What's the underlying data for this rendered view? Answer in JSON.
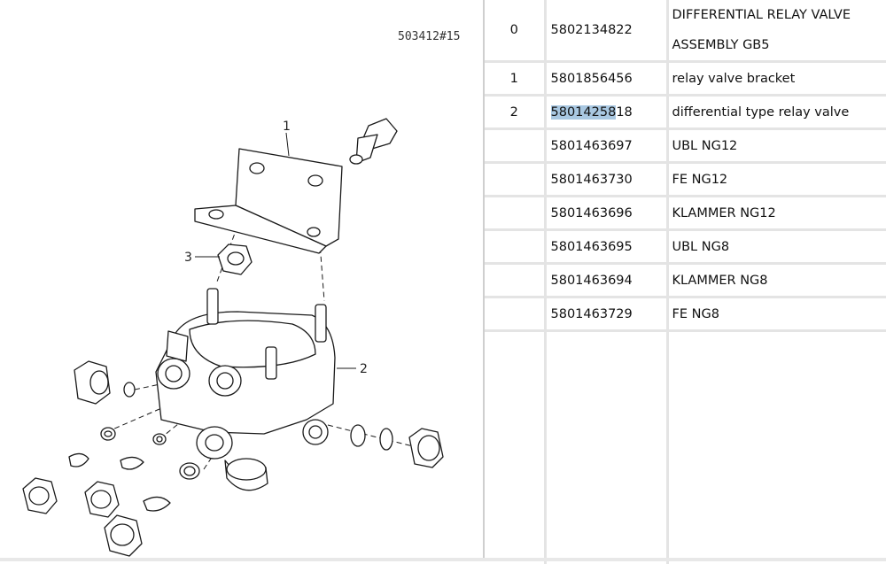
{
  "diagram": {
    "drawing_id": "503412#15",
    "callouts": [
      "1",
      "2",
      "3"
    ]
  },
  "parts_table": {
    "rows": [
      {
        "pos": "0",
        "part_number": "5802134822",
        "description_lines": [
          "DIFFERENTIAL RELAY VALVE",
          "ASSEMBLY GB5"
        ]
      },
      {
        "pos": "1",
        "part_number": "5801856456",
        "description": "relay valve bracket"
      },
      {
        "pos": "2",
        "part_number_selected": "58014258",
        "part_number_rest": "18",
        "description": "differential type relay valve"
      },
      {
        "pos": "",
        "part_number": "5801463697",
        "description": "UBL NG12"
      },
      {
        "pos": "",
        "part_number": "5801463730",
        "description": "FE NG12"
      },
      {
        "pos": "",
        "part_number": "5801463696",
        "description": "KLAMMER NG12"
      },
      {
        "pos": "",
        "part_number": "5801463695",
        "description": "UBL NG8"
      },
      {
        "pos": "",
        "part_number": "5801463694",
        "description": "KLAMMER NG8"
      },
      {
        "pos": "",
        "part_number": "5801463729",
        "description": "FE NG8"
      }
    ]
  },
  "colors": {
    "selection_highlight": "#a9c8e2",
    "grid_line": "#e4e4e4",
    "drawing_stroke": "#1a1a1a"
  }
}
